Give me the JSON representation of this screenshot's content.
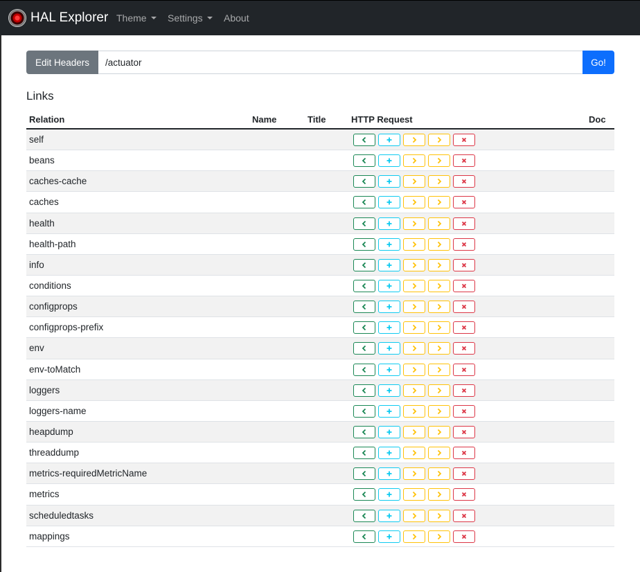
{
  "navbar": {
    "brand": "HAL Explorer",
    "theme_label": "Theme",
    "settings_label": "Settings",
    "about_label": "About"
  },
  "request": {
    "edit_headers_label": "Edit Headers",
    "url_value": "/actuator",
    "go_label": "Go!"
  },
  "links": {
    "heading": "Links",
    "columns": {
      "relation": "Relation",
      "name": "Name",
      "title": "Title",
      "http_request": "HTTP Request",
      "doc": "Doc"
    },
    "rows": [
      {
        "relation": "self"
      },
      {
        "relation": "beans"
      },
      {
        "relation": "caches-cache"
      },
      {
        "relation": "caches"
      },
      {
        "relation": "health"
      },
      {
        "relation": "health-path"
      },
      {
        "relation": "info"
      },
      {
        "relation": "conditions"
      },
      {
        "relation": "configprops"
      },
      {
        "relation": "configprops-prefix"
      },
      {
        "relation": "env"
      },
      {
        "relation": "env-toMatch"
      },
      {
        "relation": "loggers"
      },
      {
        "relation": "loggers-name"
      },
      {
        "relation": "heapdump"
      },
      {
        "relation": "threaddump"
      },
      {
        "relation": "metrics-requiredMetricName"
      },
      {
        "relation": "metrics"
      },
      {
        "relation": "scheduledtasks"
      },
      {
        "relation": "mappings"
      }
    ],
    "row_actions": [
      {
        "method": "get",
        "icon": "chevron-left-icon",
        "color": "#198754"
      },
      {
        "method": "post",
        "icon": "plus-icon",
        "color": "#0dcaf0"
      },
      {
        "method": "put",
        "icon": "chevron-right-icon",
        "color": "#ffc107"
      },
      {
        "method": "patch",
        "icon": "chevron-right-icon",
        "color": "#ffc107"
      },
      {
        "method": "delete",
        "icon": "x-icon",
        "color": "#dc3545"
      }
    ]
  },
  "colors": {
    "navbar_bg": "#212529",
    "primary": "#0d6efd",
    "secondary": "#6c757d",
    "stripe": "#f2f2f2"
  }
}
